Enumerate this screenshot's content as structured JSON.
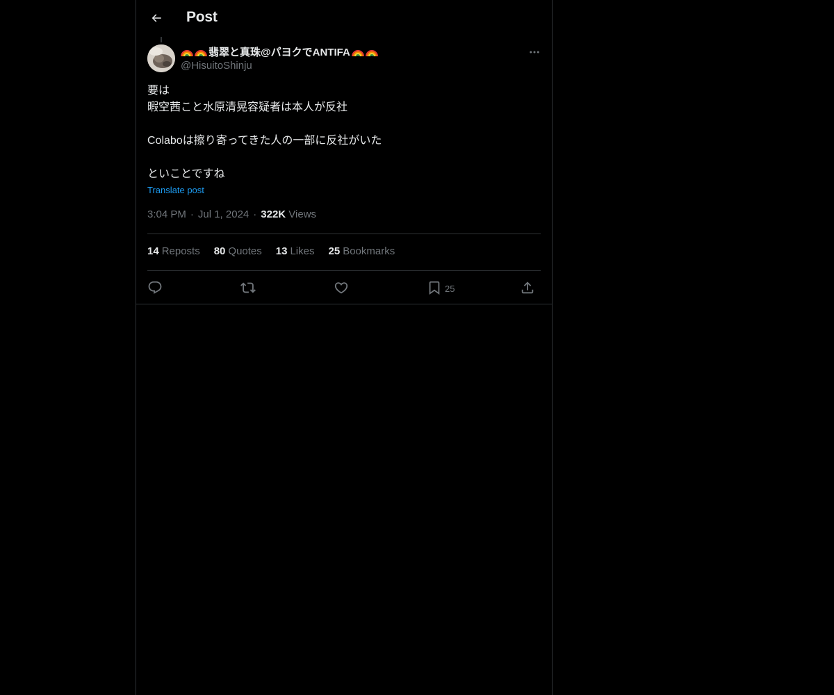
{
  "header": {
    "title": "Post"
  },
  "author": {
    "display_name": "翡翠と真珠@パヨクでANTIFA",
    "handle": "@HisuitoShinju"
  },
  "post": {
    "lines": [
      "要は",
      "暇空茜こと水原清晃容疑者は本人が反社",
      "",
      "Colaboは擦り寄ってきた人の一部に反社がいた",
      "",
      "といことですね"
    ],
    "translate_label": "Translate post",
    "time": "3:04 PM",
    "date": "Jul 1, 2024",
    "views_count": "322K",
    "views_label": "Views"
  },
  "stats": {
    "reposts_count": "14",
    "reposts_label": "Reposts",
    "quotes_count": "80",
    "quotes_label": "Quotes",
    "likes_count": "13",
    "likes_label": "Likes",
    "bookmarks_count": "25",
    "bookmarks_label": "Bookmarks"
  },
  "actions": {
    "bookmark_count": "25"
  },
  "icons": {
    "back": "arrow-left-icon",
    "more": "more-horizontal-icon",
    "reply": "reply-icon",
    "repost": "repost-icon",
    "like": "heart-icon",
    "bookmark": "bookmark-icon",
    "share": "share-icon",
    "rainbow": "rainbow-emoji"
  },
  "colors": {
    "background": "#000000",
    "text": "#e7e9ea",
    "muted": "#71767b",
    "accent": "#1d9bf0",
    "border": "#2f3336"
  }
}
